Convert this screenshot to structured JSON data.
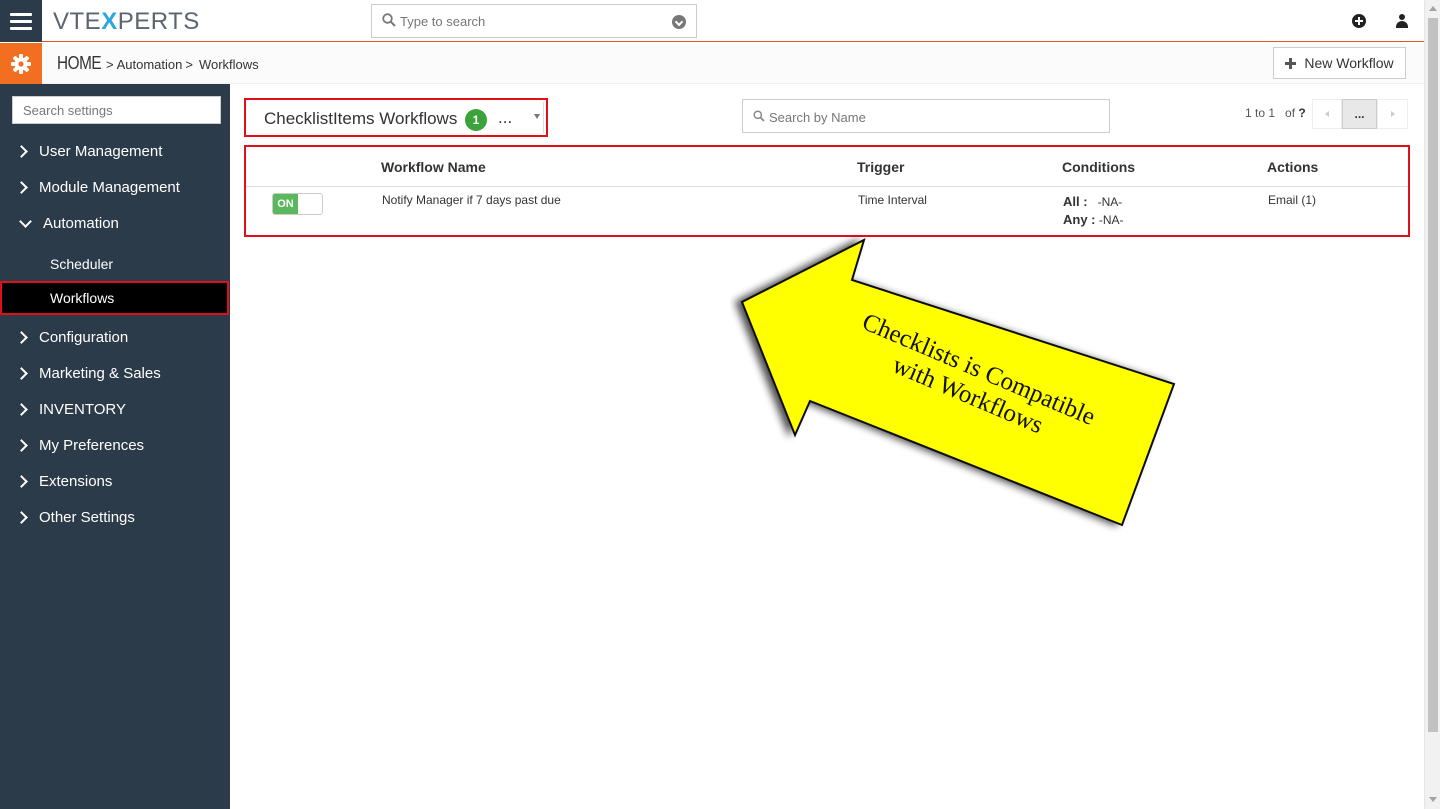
{
  "topbar": {
    "logo_left": "VTE",
    "logo_x": "X",
    "logo_right": "PERTS",
    "search_placeholder": "Type to search"
  },
  "breadcrumb": {
    "home": "HOME",
    "sep1": ">",
    "automation": "Automation",
    "sep2": ">",
    "workflows": "Workflows"
  },
  "header": {
    "new_workflow_label": "New Workflow"
  },
  "sidebar": {
    "search_placeholder": "Search settings",
    "items": [
      {
        "label": "User Management",
        "expanded": false
      },
      {
        "label": "Module Management",
        "expanded": false
      },
      {
        "label": "Automation",
        "expanded": true
      },
      {
        "label": "Configuration",
        "expanded": false
      },
      {
        "label": "Marketing & Sales",
        "expanded": false
      },
      {
        "label": "INVENTORY",
        "expanded": false
      },
      {
        "label": "My Preferences",
        "expanded": false
      },
      {
        "label": "Extensions",
        "expanded": false
      },
      {
        "label": "Other Settings",
        "expanded": false
      }
    ],
    "automation_sub": [
      {
        "label": "Scheduler",
        "active": false
      },
      {
        "label": "Workflows",
        "active": true
      }
    ]
  },
  "module_select": {
    "label": "ChecklistItems Workflows",
    "count": "1",
    "more": "..."
  },
  "name_search": {
    "placeholder": "Search by Name"
  },
  "pager": {
    "range": "1 to 1",
    "of_label": "of",
    "total": "?",
    "middle": "..."
  },
  "table": {
    "headers": [
      "Workflow Name",
      "Trigger",
      "Conditions",
      "Actions"
    ],
    "rows": [
      {
        "status": "ON",
        "name": "Notify Manager if 7 days past due",
        "trigger": "Time Interval",
        "cond_all_label": "All :",
        "cond_all_value": "-NA-",
        "cond_any_label": "Any :",
        "cond_any_value": "-NA-",
        "actions": "Email (1)"
      }
    ]
  },
  "annotation": {
    "line1": "Checklists is Compatible",
    "line2": "with Workflows"
  },
  "colors": {
    "sidebar_bg": "#2c3b49",
    "accent_orange": "#f26f21",
    "highlight_red": "#e0101a",
    "toggle_green": "#5cb85c",
    "badge_green": "#3ba33b",
    "annotation_yellow": "#ffff00"
  }
}
